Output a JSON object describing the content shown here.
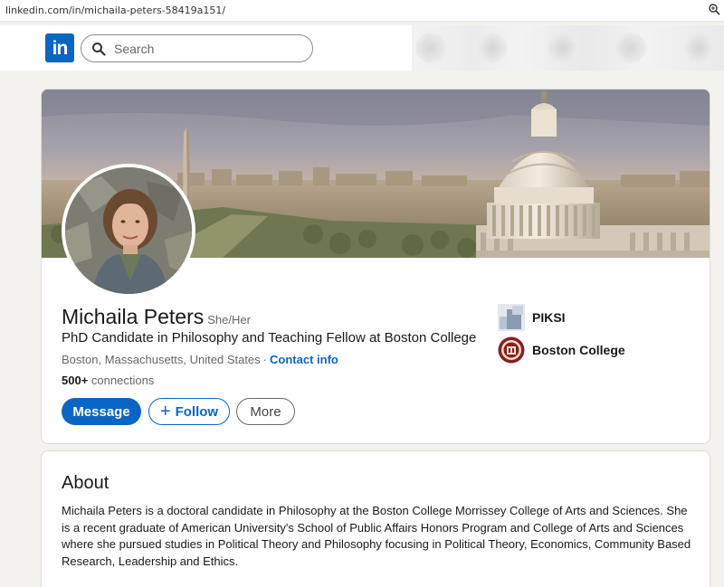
{
  "browser": {
    "url": "linkedin.com/in/michaila-peters-58419a151/",
    "zoom_icon": "zoom-icon"
  },
  "nav": {
    "logo_text": "in",
    "search_placeholder": "Search",
    "search_icon": "search-icon"
  },
  "profile": {
    "name": "Michaila Peters",
    "pronouns": "She/Her",
    "headline": "PhD Candidate in Philosophy and Teaching Fellow at Boston College",
    "location": "Boston, Massachusetts, United States",
    "location_separator": "·",
    "contact_label": "Contact info",
    "connections_count": "500+",
    "connections_label": "connections",
    "buttons": {
      "message": "Message",
      "follow": "Follow",
      "more": "More"
    },
    "organizations": [
      {
        "name": "PIKSI",
        "icon": "piksi-logo-icon"
      },
      {
        "name": "Boston College",
        "icon": "boston-college-seal-icon"
      }
    ]
  },
  "about": {
    "title": "About",
    "text": "Michaila Peters is a doctoral candidate in Philosophy at the Boston College Morrissey College of Arts and Sciences. She is a recent graduate of American University's School of Public Affairs Honors Program and College of Arts and Sciences where she pursued studies in Political Theory and Philosophy focusing in Political Theory, Economics, Community Based Research, Leadership and Ethics."
  },
  "colors": {
    "brand": "#0a66c2",
    "page_bg": "#f4f2ee"
  }
}
